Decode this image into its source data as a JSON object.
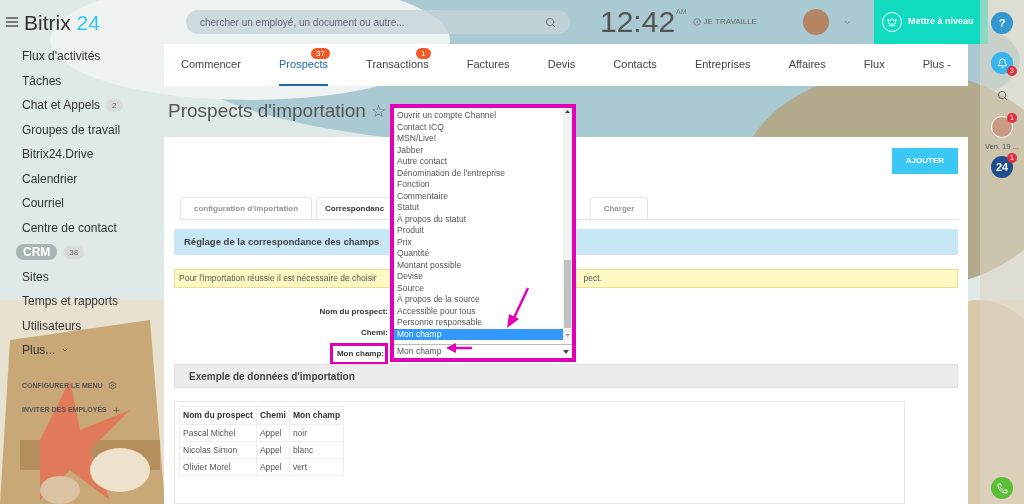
{
  "sidebar": {
    "logo": {
      "name": "Bitrix",
      "suffix": "24"
    },
    "items": [
      {
        "label": "Flux d'activités",
        "selected": false
      },
      {
        "label": "Tâches",
        "selected": false
      },
      {
        "label": "Chat et Appels",
        "badge": "2",
        "selected": false
      },
      {
        "label": "Groupes de travail",
        "selected": false
      },
      {
        "label": "Bitrix24.Drive",
        "selected": false
      },
      {
        "label": "Calendrier",
        "selected": false
      },
      {
        "label": "Courriel",
        "selected": false
      },
      {
        "label": "Centre de contact",
        "selected": false
      },
      {
        "label": "CRM",
        "badge": "38",
        "selected": true
      },
      {
        "label": "Sites",
        "selected": false
      },
      {
        "label": "Temps et rapports",
        "selected": false
      },
      {
        "label": "Utilisateurs",
        "selected": false
      },
      {
        "label": "Plus...",
        "selected": false,
        "kind": "more"
      }
    ],
    "footer": [
      {
        "label": "CONFIGURER LE MENU",
        "kind": "settings"
      },
      {
        "label": "INVITER DES EMPLOYÉS",
        "kind": "add"
      }
    ]
  },
  "header": {
    "search": {
      "placeholder": "chercher un employé, un document ou autre..."
    },
    "clock": {
      "time": "12:42",
      "period": "AM"
    },
    "status": "JE TRAVAILLE",
    "upgrade": "Mettre à niveau"
  },
  "nav": [
    {
      "label": "Commencer",
      "selected": false
    },
    {
      "label": "Prospects",
      "badge": "37",
      "selected": true
    },
    {
      "label": "Transactions",
      "badge": "1",
      "selected": false
    },
    {
      "label": "Factures",
      "selected": false
    },
    {
      "label": "Devis",
      "selected": false
    },
    {
      "label": "Contacts",
      "selected": false
    },
    {
      "label": "Entreprises",
      "selected": false
    },
    {
      "label": "Affaires",
      "selected": false
    },
    {
      "label": "Flux",
      "selected": false
    },
    {
      "label": "Plus -",
      "selected": false
    }
  ],
  "page_title": "Prospects d'importation",
  "favorite": "☆",
  "card": {
    "add_button": "AJOUTER",
    "tabs": [
      {
        "label": "configuration d'importation",
        "selected": false
      },
      {
        "label": "Correspondanc",
        "selected": true
      },
      {
        "label": "Charger",
        "selected": false
      }
    ],
    "section": "Réglage de la correspondance des champs",
    "notice": {
      "text": "Pour l'importation réussie il est nécessaire de choisir",
      "tail": "pect."
    },
    "fields": [
      {
        "label": "Nom du prospect:",
        "highlighted": false
      },
      {
        "label": "Chemi:",
        "highlighted": false
      },
      {
        "label": "Mon champ:",
        "highlighted": true
      }
    ],
    "sample_title": "Exemple de données d'importation",
    "table": {
      "columns": [
        "Nom du prospect",
        "Chemi",
        "Mon champ"
      ],
      "rows": [
        [
          "Pascal Michel",
          "Appel",
          "noir"
        ],
        [
          "Nicolas Simon",
          "Appel",
          "blanc"
        ],
        [
          "Olivier Morel",
          "Appel",
          "vert"
        ]
      ]
    }
  },
  "dropdown": {
    "options": [
      {
        "label": "Ouvrir un compte Channel",
        "selected": false
      },
      {
        "label": "Contact ICQ",
        "selected": false
      },
      {
        "label": "MSN/Live!",
        "selected": false
      },
      {
        "label": "Jabber",
        "selected": false
      },
      {
        "label": "Autre contact",
        "selected": false
      },
      {
        "label": "Dénomination de l'entreprise",
        "selected": false
      },
      {
        "label": "Fonction",
        "selected": false
      },
      {
        "label": "Commentaire",
        "selected": false
      },
      {
        "label": "Statut",
        "selected": false
      },
      {
        "label": "À propos du statut",
        "selected": false
      },
      {
        "label": "Produit",
        "selected": false
      },
      {
        "label": "Prix",
        "selected": false
      },
      {
        "label": "Quantité",
        "selected": false
      },
      {
        "label": "Montant possible",
        "selected": false
      },
      {
        "label": "Devise",
        "selected": false
      },
      {
        "label": "Source",
        "selected": false
      },
      {
        "label": "À propos de la source",
        "selected": false
      },
      {
        "label": "Accessible pour tous",
        "selected": false
      },
      {
        "label": "Personne responsable",
        "selected": false
      },
      {
        "label": "Mon champ",
        "selected": true
      }
    ],
    "value": "Mon champ"
  },
  "right_bar": {
    "help": "?",
    "notifications": "3",
    "chat_badge": "1",
    "chat_date": "Ven. 19 ...",
    "app_label": "24",
    "app_badge": "1"
  }
}
